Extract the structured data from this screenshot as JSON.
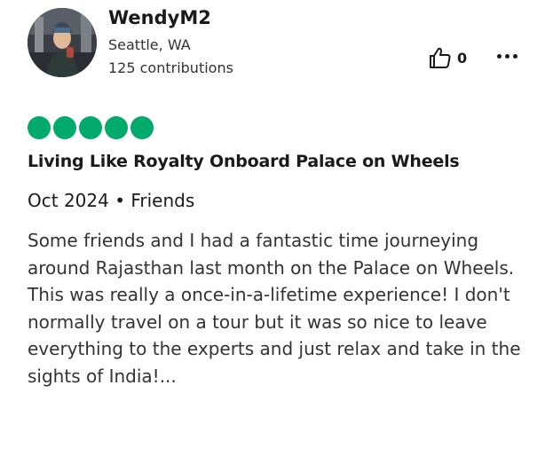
{
  "user": {
    "name": "WendyM2",
    "location": "Seattle, WA",
    "contributions": "125 contributions",
    "avatar_icon": "user-photo"
  },
  "actions": {
    "helpful_icon": "thumbs-up-icon",
    "helpful_count": "0",
    "more_icon": "more-options-icon"
  },
  "review": {
    "rating": 5,
    "rating_max": 5,
    "rating_color": "#00aa6c",
    "title": "Living Like Royalty Onboard Palace on Wheels",
    "meta": "Oct 2024 • Friends",
    "body": "Some friends and I had a fantastic time journeying around Rajasthan last month on the Palace on Wheels. This was really a once-in-a-lifetime experience! I don't normally travel on a tour but it was so nice to leave everything to the experts and just relax and take in the sights of India!..."
  }
}
